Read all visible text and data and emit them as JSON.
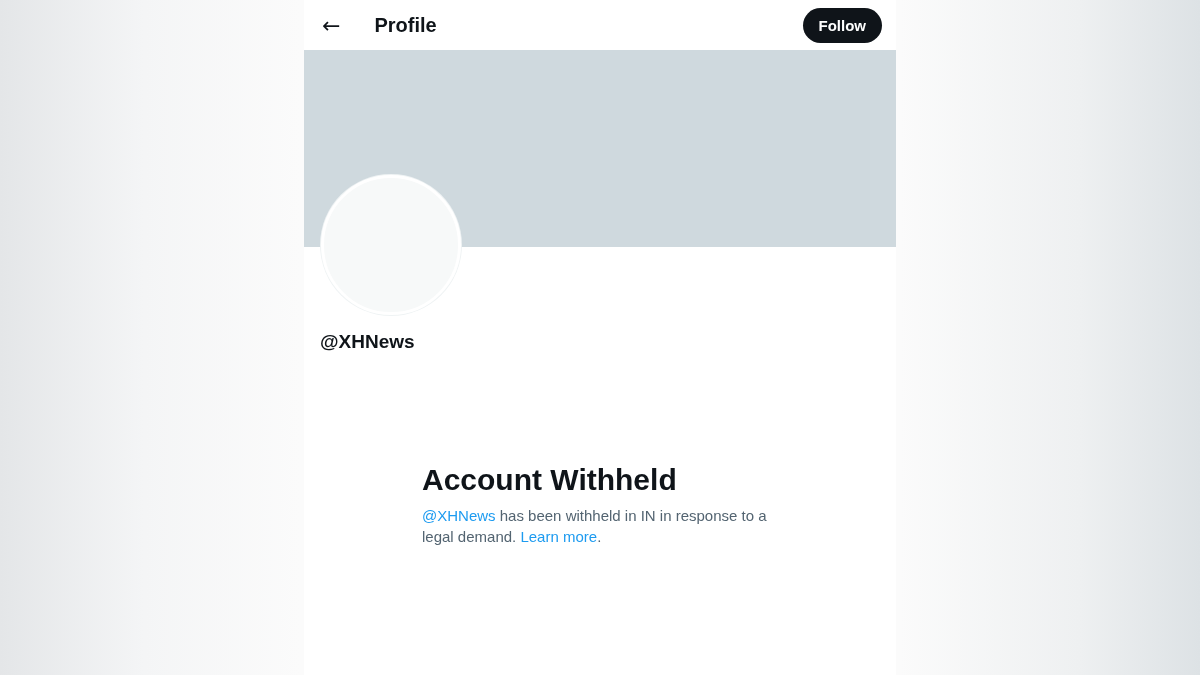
{
  "header": {
    "back_icon": "←",
    "title": "Profile",
    "follow_button": "Follow"
  },
  "profile": {
    "handle": "@XHNews"
  },
  "notice": {
    "title": "Account Withheld",
    "mention": "@XHNews",
    "text": " has been withheld in IN in response to a legal demand. ",
    "link": "Learn more",
    "end": "."
  }
}
